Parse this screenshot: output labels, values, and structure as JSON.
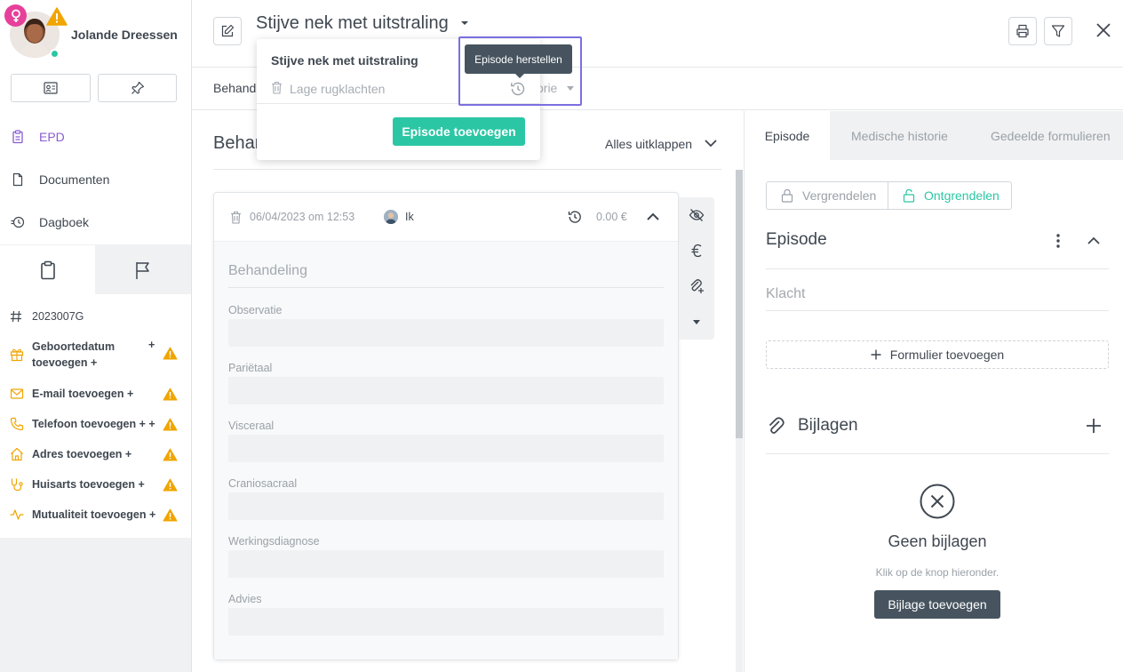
{
  "patient": {
    "name": "Jolande Dreessen"
  },
  "sidebar": {
    "nav": [
      {
        "label": "EPD",
        "icon": "clipboard-icon",
        "active_color": "#8a5cd0"
      },
      {
        "label": "Documenten",
        "icon": "document-icon"
      },
      {
        "label": "Dagboek",
        "icon": "history-icon"
      }
    ],
    "info": [
      {
        "label": "2023007G",
        "icon": "hash-icon"
      },
      {
        "label": "Geboortedatum toevoegen +",
        "icon": "gift-icon",
        "plus": "+"
      },
      {
        "label": "E-mail toevoegen +",
        "icon": "mail-icon"
      },
      {
        "label": "Telefoon toevoegen + +",
        "icon": "phone-icon"
      },
      {
        "label": "Adres toevoegen +",
        "icon": "home-icon"
      },
      {
        "label": "Huisarts toevoegen +",
        "icon": "stethoscope-icon"
      },
      {
        "label": "Mutualiteit toevoegen +",
        "icon": "pulse-icon"
      }
    ]
  },
  "header": {
    "title": "Stijve nek met uitstraling"
  },
  "subnav": {
    "left": "Behand",
    "right": "orie"
  },
  "dropdown": {
    "item1": "Stijve nek met uitstraling",
    "item2": "Lage rugklachten",
    "add_button": "Episode toevoegen",
    "tooltip": "Episode herstellen"
  },
  "middle": {
    "title": "Behan",
    "expand_all": "Alles uitklappen",
    "entry": {
      "date": "06/04/2023 om 12:53",
      "author": "Ik",
      "price": "0.00 €",
      "body_title": "Behandeling",
      "fields": [
        "Observatie",
        "Pariëtaal",
        "Visceraal",
        "Craniosacraal",
        "Werkingsdiagnose",
        "Advies"
      ]
    }
  },
  "right": {
    "tabs": [
      "Episode",
      "Medische historie",
      "Gedeelde formulieren"
    ],
    "lock": "Vergrendelen",
    "unlock": "Ontgrendelen",
    "episode_title": "Episode",
    "complaint_placeholder": "Klacht",
    "add_form": "Formulier toevoegen",
    "attachments_title": "Bijlagen",
    "no_attachments": "Geen bijlagen",
    "no_attachments_sub": "Klik op de knop hieronder.",
    "add_attachment": "Bijlage toevoegen"
  },
  "colors": {
    "accent": "#2bc7a4",
    "warning": "#f0a500",
    "purple": "#8a5cd0",
    "dark_button": "#47545f",
    "gender": "#e6409a"
  }
}
